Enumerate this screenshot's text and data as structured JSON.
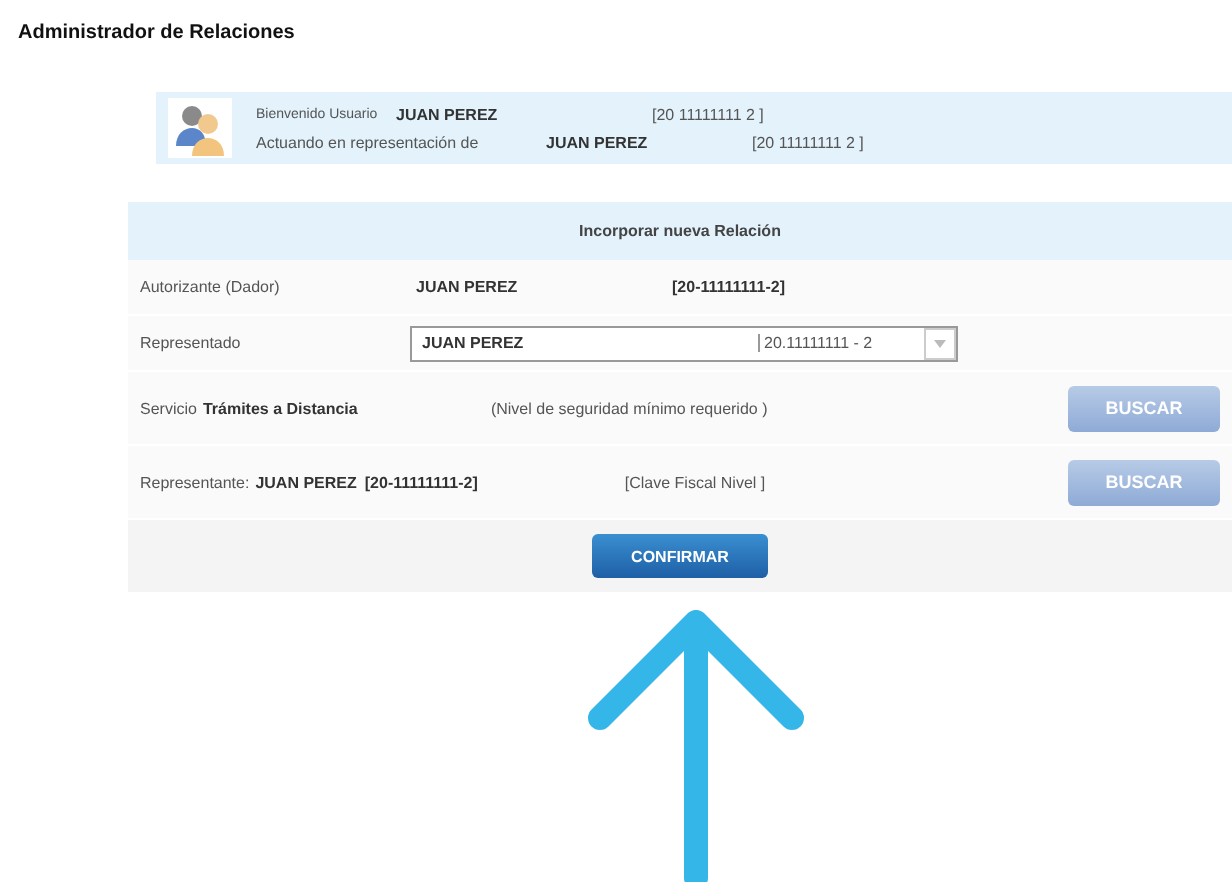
{
  "title": "Administrador de Relaciones",
  "welcome": {
    "greeting": "Bienvenido Usuario",
    "user": "JUAN PEREZ",
    "user_id": "[20 11111111 2 ]",
    "acting_label": "Actuando en representación de",
    "acting_user": "JUAN PEREZ",
    "acting_id": "[20 11111111 2 ]"
  },
  "form": {
    "heading": "Incorporar nueva Relación",
    "autorizante": {
      "label": "Autorizante (Dador)",
      "name": "JUAN PEREZ",
      "id": "[20-11111111-2]"
    },
    "representado": {
      "label": "Representado",
      "value": "JUAN PEREZ",
      "id": "20.11111111 - 2"
    },
    "servicio": {
      "label": "Servicio",
      "name": "Trámites a Distancia",
      "note": "(Nivel de seguridad mínimo requerido   )",
      "button": "BUSCAR"
    },
    "representante": {
      "label": "Representante:",
      "name": "JUAN PEREZ",
      "id": "[20-11111111-2]",
      "note": "[Clave Fiscal Nivel   ]",
      "button": "BUSCAR"
    },
    "confirm": "CONFIRMAR"
  }
}
